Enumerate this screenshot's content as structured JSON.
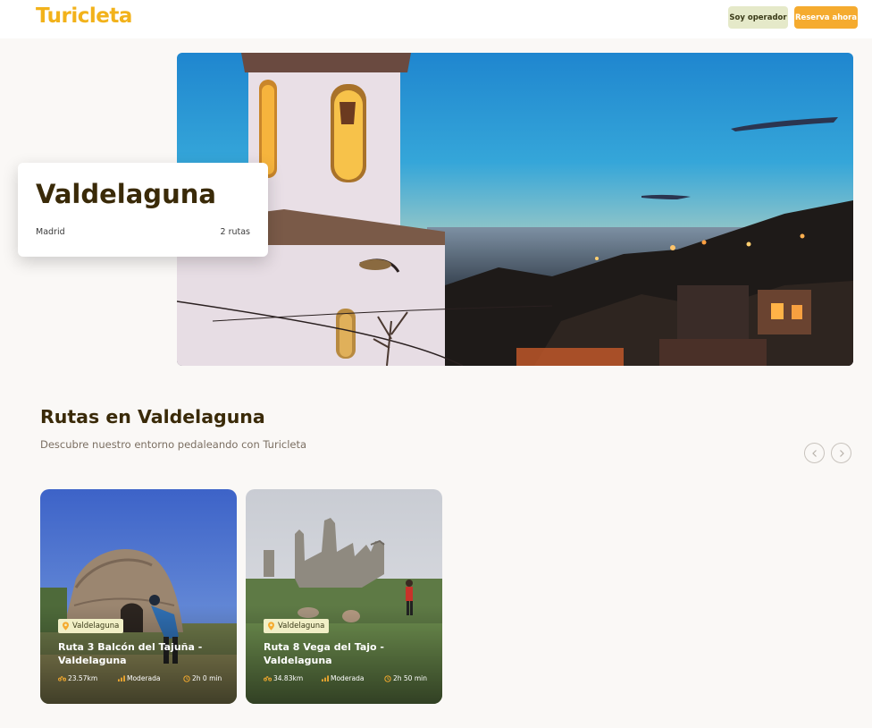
{
  "app": {
    "logo": "Turicleta",
    "operator_button": "Soy operador",
    "book_button": "Reserva ahora"
  },
  "town": {
    "name": "Valdelaguna",
    "region": "Madrid",
    "routes_count": "2 rutas"
  },
  "section": {
    "title": "Rutas en Valdelaguna",
    "subtitle": "Descubre nuestro entorno pedaleando con Turicleta"
  },
  "routes": [
    {
      "location": "Valdelaguna",
      "title": "Ruta 3 Balcón del Tajuña - Valdelaguna",
      "distance": "23.57km",
      "difficulty": "Moderada",
      "duration": "2h 0 min"
    },
    {
      "location": "Valdelaguna",
      "title": "Ruta 8 Vega del Tajo - Valdelaguna",
      "distance": "34.83km",
      "difficulty": "Moderada",
      "duration": "2h 50 min"
    }
  ],
  "colors": {
    "brand": "#f2b21b",
    "accent_button": "#f5ab2f",
    "secondary_button": "#e5e9c9",
    "badge": "#f1efc6"
  },
  "icons": [
    "location-pin-icon",
    "bike-icon",
    "difficulty-icon",
    "clock-icon",
    "chevron-left-icon",
    "chevron-right-icon"
  ]
}
